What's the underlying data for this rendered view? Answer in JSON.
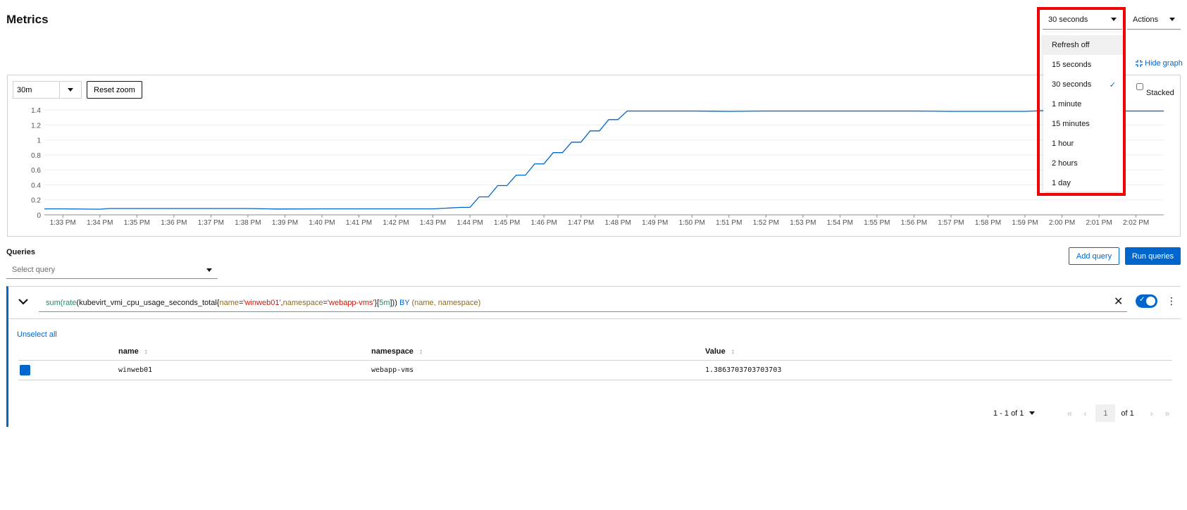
{
  "page": {
    "title": "Metrics"
  },
  "header": {
    "refresh_selected": "30 seconds",
    "actions_label": "Actions"
  },
  "refresh_menu": {
    "items": [
      {
        "label": "Refresh off",
        "selected": false
      },
      {
        "label": "15 seconds",
        "selected": false
      },
      {
        "label": "30 seconds",
        "selected": true
      },
      {
        "label": "1 minute",
        "selected": false
      },
      {
        "label": "15 minutes",
        "selected": false
      },
      {
        "label": "1 hour",
        "selected": false
      },
      {
        "label": "2 hours",
        "selected": false
      },
      {
        "label": "1 day",
        "selected": false
      }
    ]
  },
  "graph": {
    "hide_graph_label": "Hide graph",
    "span_value": "30m",
    "reset_zoom_label": "Reset zoom",
    "stacked_label": "Stacked",
    "stacked_checked": false
  },
  "chart_data": {
    "type": "line",
    "x": [
      "1:32:30 PM",
      "1:33 PM",
      "1:34 PM",
      "1:34:15 PM",
      "1:35 PM",
      "1:36 PM",
      "1:37 PM",
      "1:38 PM",
      "1:38:45 PM",
      "1:39 PM",
      "1:40 PM",
      "1:41 PM",
      "1:42 PM",
      "1:43 PM",
      "1:43:45 PM",
      "1:44 PM",
      "1:44:15 PM",
      "1:44:30 PM",
      "1:44:45 PM",
      "1:45 PM",
      "1:45:15 PM",
      "1:45:30 PM",
      "1:45:45 PM",
      "1:46 PM",
      "1:46:15 PM",
      "1:46:30 PM",
      "1:46:45 PM",
      "1:47 PM",
      "1:47:15 PM",
      "1:47:30 PM",
      "1:47:45 PM",
      "1:48 PM",
      "1:48:15 PM",
      "1:49 PM",
      "1:50 PM",
      "1:51 PM",
      "1:52 PM",
      "1:53 PM",
      "1:54 PM",
      "1:55 PM",
      "1:56 PM",
      "1:57 PM",
      "1:58 PM",
      "1:59 PM",
      "1:59:30 PM",
      "2:00 PM",
      "2:01 PM",
      "2:02 PM",
      "2:02:45 PM"
    ],
    "series": [
      {
        "name": "winweb01",
        "color": "#0066cc",
        "values": [
          0.08,
          0.08,
          0.075,
          0.085,
          0.085,
          0.085,
          0.085,
          0.085,
          0.078,
          0.078,
          0.08,
          0.08,
          0.08,
          0.08,
          0.1,
          0.1,
          0.24,
          0.24,
          0.39,
          0.39,
          0.53,
          0.53,
          0.68,
          0.68,
          0.83,
          0.83,
          0.97,
          0.97,
          1.12,
          1.12,
          1.27,
          1.27,
          1.385,
          1.385,
          1.385,
          1.38,
          1.385,
          1.385,
          1.385,
          1.385,
          1.385,
          1.38,
          1.38,
          1.38,
          1.39,
          1.385,
          1.385,
          1.385,
          1.385
        ]
      }
    ],
    "x_ticks": [
      "1:33 PM",
      "1:34 PM",
      "1:35 PM",
      "1:36 PM",
      "1:37 PM",
      "1:38 PM",
      "1:39 PM",
      "1:40 PM",
      "1:41 PM",
      "1:42 PM",
      "1:43 PM",
      "1:44 PM",
      "1:45 PM",
      "1:46 PM",
      "1:47 PM",
      "1:48 PM",
      "1:49 PM",
      "1:50 PM",
      "1:51 PM",
      "1:52 PM",
      "1:53 PM",
      "1:54 PM",
      "1:55 PM",
      "1:56 PM",
      "1:57 PM",
      "1:58 PM",
      "1:59 PM",
      "2:00 PM",
      "2:01 PM",
      "2:02 PM"
    ],
    "y_ticks": [
      "0",
      "0.2",
      "0.4",
      "0.6",
      "0.8",
      "1",
      "1.2",
      "1.4"
    ],
    "ylim": [
      0,
      1.4
    ],
    "grid": true,
    "title": "",
    "xlabel": "",
    "ylabel": ""
  },
  "queries": {
    "label": "Queries",
    "select_placeholder": "Select query",
    "add_query_label": "Add query",
    "run_queries_label": "Run queries",
    "query": {
      "fn1": "sum(",
      "fn2": "rate",
      "paren": "(",
      "metric": "kubevirt_vmi_cpu_usage_seconds_total{",
      "label1": "name",
      "eq1": "=",
      "str1": "'winweb01'",
      "comma": ",",
      "label2": "namespace",
      "eq2": "=",
      "str2": "'webapp-vms'",
      "close1": "}[",
      "range": "5m",
      "close2": "])) ",
      "by": "BY",
      "group": " (name, namespace)",
      "enabled": true
    },
    "unselect_all_label": "Unselect all",
    "table": {
      "columns": [
        "name",
        "namespace",
        "Value"
      ],
      "rows": [
        {
          "name": "winweb01",
          "namespace": "webapp-vms",
          "value": "1.3863703703703703",
          "color": "#0066cc"
        }
      ]
    },
    "pagination": {
      "range_label": "1 - 1 of 1",
      "page": "1",
      "of_label": "of 1"
    }
  }
}
